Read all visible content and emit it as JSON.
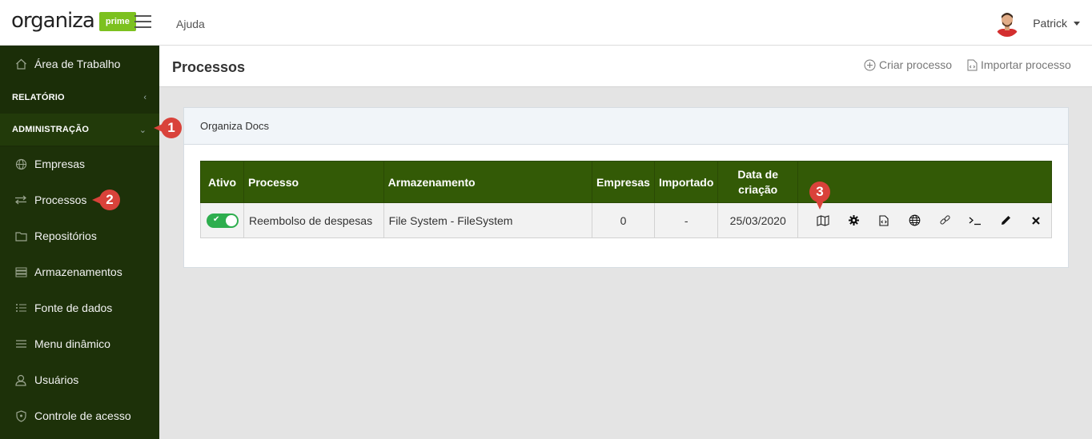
{
  "brand": {
    "name": "organiza",
    "badge": "prime",
    "badge_color": "#7cc11f"
  },
  "topbar": {
    "help_label": "Ajuda",
    "user_name": "Patrick"
  },
  "sidebar": {
    "items": [
      {
        "label": "Área de Trabalho",
        "icon": "home-icon"
      },
      {
        "label": "RELATÓRIO",
        "icon": "chevron-left-icon"
      },
      {
        "label": "ADMINISTRAÇÃO",
        "icon": "chevron-down-icon"
      },
      {
        "label": "Empresas",
        "icon": "globe-icon"
      },
      {
        "label": "Processos",
        "icon": "arrows-icon"
      },
      {
        "label": "Repositórios",
        "icon": "folder-icon"
      },
      {
        "label": "Armazenamentos",
        "icon": "storage-icon"
      },
      {
        "label": "Fonte de dados",
        "icon": "list-icon"
      },
      {
        "label": "Menu dinâmico",
        "icon": "menu-icon"
      },
      {
        "label": "Usuários",
        "icon": "user-icon"
      },
      {
        "label": "Controle de acesso",
        "icon": "shield-icon"
      }
    ]
  },
  "header": {
    "title": "Processos",
    "create_label": "Criar processo",
    "import_label": "Importar processo"
  },
  "card": {
    "title": "Organiza Docs",
    "table": {
      "columns": [
        "Ativo",
        "Processo",
        "Armazenamento",
        "Empresas",
        "Importado",
        "Data de criação",
        ""
      ],
      "rows": [
        {
          "active": true,
          "process": "Reembolso de despesas",
          "storage": "File System - FileSystem",
          "companies": "0",
          "imported": "-",
          "created": "25/03/2020",
          "actions": [
            "map-icon",
            "gear-icon",
            "code-file-icon",
            "globe-icon",
            "link-icon",
            "terminal-icon",
            "pencil-icon",
            "close-icon"
          ]
        }
      ]
    }
  },
  "markers": {
    "m1": "1",
    "m2": "2",
    "m3": "3"
  },
  "colors": {
    "sidebar_bg": "#1b2e08",
    "table_header": "#335a06",
    "toggle_on": "#2eae4e",
    "marker": "#d9423a"
  }
}
